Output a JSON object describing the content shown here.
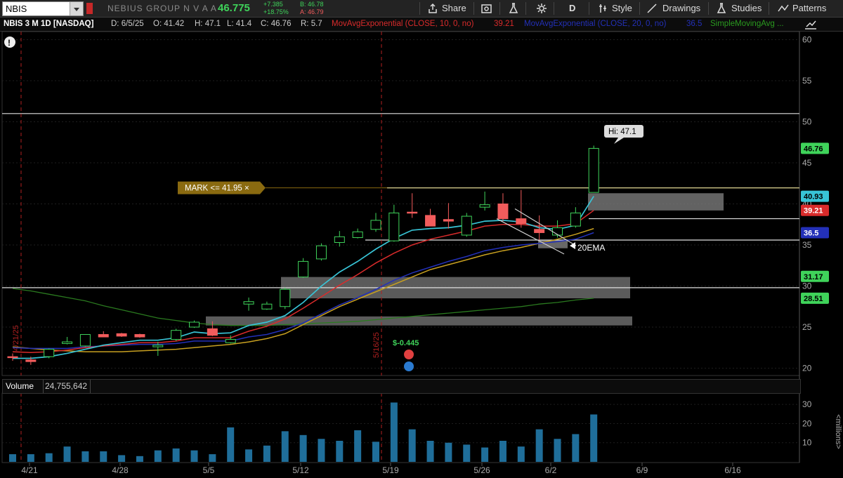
{
  "toolbar": {
    "symbol": "NBIS",
    "company": "NEBIUS GROUP N V A A",
    "last": "46.775",
    "net_change": "+7.385",
    "pct_change": "+18.75%",
    "bid": "B: 46.78",
    "ask": "A: 46.79",
    "share": "Share",
    "period": "D",
    "style": "Style",
    "drawings": "Drawings",
    "studies": "Studies",
    "patterns": "Patterns"
  },
  "info": {
    "title": "NBIS 3 M 1D [NASDAQ]",
    "date": "D: 6/5/25",
    "open": "O: 41.42",
    "high": "H: 47.1",
    "low": "L: 41.4",
    "close": "C: 46.76",
    "range": "R: 5.7",
    "ema10_label": "MovAvgExponential (CLOSE, 10, 0, no)",
    "ema10_value": "39.21",
    "ema20_label": "MovAvgExponential (CLOSE, 20, 0, no)",
    "ema20_value": "36.5",
    "sma_label": "SimpleMovingAvg ..."
  },
  "volume": {
    "label": "Volume",
    "value": "24,755,642",
    "unit": "millions"
  },
  "annotations": {
    "mark": "MARK <= 41.95 ×",
    "hi": "Hi: 47.1",
    "ema_note": "20EMA",
    "dividend": "$-0.445",
    "date_marker_1": "4/21/25",
    "date_marker_2": "5/16/25"
  },
  "colors": {
    "up": "#3fd35a",
    "down": "#f25c5c",
    "ema10": "#d92b2b",
    "ema20": "#2330b8",
    "ema_fast": "#38c4d6",
    "sma_yellow": "#c8a020",
    "sma_green": "#2a7a1f",
    "volume": "#1f6e9a",
    "mark": "#8a6a10"
  },
  "chart_data": {
    "type": "candlestick",
    "dates": [
      "4/21",
      "4/22",
      "4/23",
      "4/24",
      "4/25",
      "4/28",
      "4/29",
      "4/30",
      "5/1",
      "5/2",
      "5/5",
      "5/6",
      "5/7",
      "5/8",
      "5/9",
      "5/12",
      "5/13",
      "5/14",
      "5/15",
      "5/16",
      "5/19",
      "5/20",
      "5/21",
      "5/22",
      "5/23",
      "5/27",
      "5/28",
      "5/29",
      "5/30",
      "6/2",
      "6/3",
      "6/4",
      "6/5"
    ],
    "open": [
      21.4,
      21.0,
      21.4,
      23.0,
      22.7,
      24.1,
      24.2,
      24.1,
      22.6,
      23.5,
      25.0,
      24.8,
      23.1,
      27.8,
      27.2,
      27.5,
      31.1,
      33.3,
      35.3,
      35.9,
      36.9,
      35.5,
      39.0,
      38.6,
      38.1,
      36.2,
      39.6,
      40.0,
      38.2,
      36.9,
      36.2,
      37.3,
      41.4
    ],
    "high": [
      21.8,
      21.4,
      22.4,
      23.8,
      24.1,
      24.5,
      24.3,
      24.2,
      23.2,
      24.8,
      25.8,
      25.7,
      24.0,
      28.6,
      28.1,
      29.8,
      33.4,
      35.2,
      36.7,
      37.0,
      38.9,
      39.9,
      41.3,
      39.4,
      40.1,
      38.9,
      41.5,
      41.3,
      41.7,
      38.6,
      38.0,
      39.6,
      47.1
    ],
    "low": [
      20.9,
      20.4,
      21.2,
      22.9,
      22.6,
      23.8,
      23.8,
      23.7,
      21.5,
      23.3,
      24.9,
      23.9,
      23.0,
      27.0,
      27.1,
      27.2,
      31.0,
      33.1,
      34.8,
      35.8,
      36.6,
      35.4,
      38.3,
      38.0,
      37.0,
      36.0,
      39.2,
      37.9,
      37.1,
      35.6,
      35.9,
      37.1,
      41.4
    ],
    "close": [
      21.3,
      20.8,
      22.3,
      23.2,
      24.1,
      23.8,
      23.9,
      23.8,
      22.8,
      24.6,
      25.6,
      24.0,
      23.5,
      28.1,
      27.8,
      29.6,
      33.0,
      34.9,
      36.0,
      36.6,
      38.0,
      38.9,
      38.9,
      37.3,
      37.9,
      38.5,
      39.9,
      38.2,
      37.6,
      36.5,
      37.1,
      38.9,
      46.76
    ],
    "volume": [
      4.0,
      4.0,
      4.5,
      8.0,
      5.5,
      5.5,
      3.5,
      3.0,
      6.0,
      7.0,
      6.0,
      4.0,
      18.0,
      6.5,
      8.5,
      16.0,
      14.0,
      12.0,
      11.0,
      16.5,
      10.5,
      31.0,
      17.0,
      11.0,
      10.0,
      9.0,
      7.5,
      11.0,
      8.0,
      17.0,
      12.0,
      14.5,
      24.76
    ],
    "ema_fast": [
      21.2,
      21.2,
      21.4,
      21.8,
      22.3,
      22.8,
      23.1,
      23.4,
      23.4,
      23.7,
      24.4,
      24.2,
      24.3,
      25.2,
      25.6,
      26.4,
      28.0,
      30.0,
      31.7,
      33.0,
      34.5,
      35.8,
      36.8,
      37.0,
      37.1,
      37.4,
      37.9,
      38.0,
      37.8,
      37.1,
      36.9,
      37.4,
      40.93
    ],
    "ema10": [
      22.0,
      21.9,
      22.0,
      22.2,
      22.5,
      22.7,
      22.9,
      23.1,
      23.1,
      23.3,
      23.7,
      23.7,
      23.7,
      24.5,
      25.1,
      26.0,
      27.3,
      28.7,
      30.1,
      31.4,
      32.8,
      34.0,
      35.0,
      35.7,
      36.2,
      36.7,
      37.3,
      37.5,
      37.5,
      37.3,
      37.3,
      37.6,
      39.21
    ],
    "ema20": [
      22.5,
      22.4,
      22.4,
      22.4,
      22.6,
      22.7,
      22.8,
      22.9,
      22.9,
      23.0,
      23.3,
      23.3,
      23.3,
      23.8,
      24.1,
      24.7,
      25.5,
      26.6,
      27.7,
      28.6,
      29.6,
      30.7,
      31.6,
      32.3,
      33.0,
      33.6,
      34.3,
      34.7,
      35.0,
      35.2,
      35.4,
      35.7,
      36.5
    ],
    "sma_yellow": [
      22.6,
      22.4,
      22.2,
      22.1,
      22.0,
      22.0,
      22.0,
      22.1,
      22.2,
      22.3,
      22.5,
      22.7,
      22.9,
      23.2,
      23.6,
      24.2,
      25.3,
      26.4,
      27.5,
      28.4,
      29.3,
      30.2,
      31.1,
      32.0,
      32.6,
      33.2,
      33.8,
      34.3,
      34.7,
      35.2,
      35.7,
      36.3,
      37.0
    ],
    "sma_green": [
      29.7,
      29.4,
      29.0,
      28.6,
      28.2,
      27.6,
      27.1,
      26.6,
      26.1,
      25.8,
      25.5,
      25.3,
      25.2,
      25.2,
      25.2,
      25.3,
      25.4,
      25.5,
      25.6,
      25.7,
      25.9,
      26.1,
      26.3,
      26.5,
      26.7,
      26.9,
      27.1,
      27.3,
      27.5,
      27.8,
      28.0,
      28.3,
      28.51
    ],
    "horizontal_lines": [
      51.0,
      41.95,
      38.2,
      35.6,
      29.8
    ],
    "price_axis": {
      "ticks": [
        20,
        25,
        30,
        35,
        40,
        45,
        50,
        55,
        60
      ],
      "ylim": [
        19.5,
        60.5
      ]
    },
    "volume_axis": {
      "ticks": [
        10,
        20,
        30
      ],
      "ylim": [
        0,
        33
      ]
    },
    "x_ticks": [
      "4/21",
      "4/28",
      "5/5",
      "5/12",
      "5/19",
      "5/26",
      "6/2",
      "6/9",
      "6/16"
    ],
    "price_labels": [
      {
        "value": "46.76",
        "color": "#3fd35a"
      },
      {
        "value": "40.93",
        "color": "#38c4d6"
      },
      {
        "value": "39.21",
        "color": "#d92b2b"
      },
      {
        "value": "36.5",
        "color": "#2330b8"
      },
      {
        "value": "31.17",
        "color": "#3fd35a"
      },
      {
        "value": "28.51",
        "color": "#3fd35a"
      }
    ]
  }
}
